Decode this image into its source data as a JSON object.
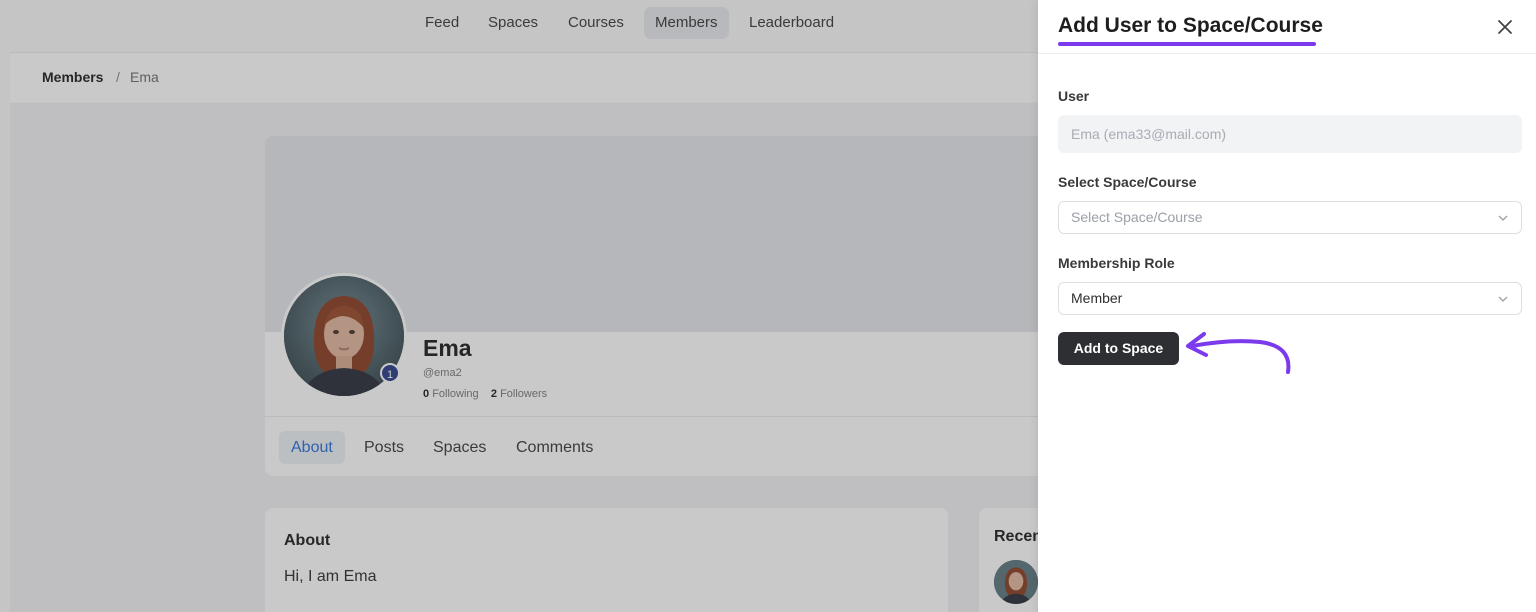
{
  "nav": {
    "items": [
      "Feed",
      "Spaces",
      "Courses",
      "Members",
      "Leaderboard"
    ],
    "active": "Members"
  },
  "breadcrumb": {
    "parent": "Members",
    "separator": "/",
    "current": "Ema"
  },
  "profile": {
    "name": "Ema",
    "handle": "@ema2",
    "badge": "1",
    "following_count": "0",
    "following_label": "Following",
    "followers_count": "2",
    "followers_label": "Followers",
    "tabs": [
      "About",
      "Posts",
      "Spaces",
      "Comments"
    ],
    "active_tab": "About"
  },
  "about": {
    "title": "About",
    "text": "Hi, I am Ema"
  },
  "recent": {
    "title": "Recen"
  },
  "drawer": {
    "title": "Add User to Space/Course",
    "user_label": "User",
    "user_value": "Ema (ema33@mail.com)",
    "space_label": "Select Space/Course",
    "space_placeholder": "Select Space/Course",
    "role_label": "Membership Role",
    "role_value": "Member",
    "submit_label": "Add to Space"
  },
  "colors": {
    "accent": "#7c3aed",
    "button_dark": "#2d2f33",
    "active_tab": "#2a6fdb",
    "avatar_badge": "#2c3e8a"
  },
  "icons": {
    "close": "close-icon",
    "chevron": "chevron-down-icon",
    "annotation_arrow": "curved-arrow-icon"
  }
}
